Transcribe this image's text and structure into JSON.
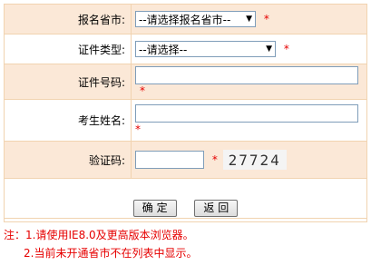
{
  "form": {
    "province": {
      "label": "报名省市:",
      "selected": "--请选择报名省市--",
      "required": "*"
    },
    "id_type": {
      "label": "证件类型:",
      "selected": "--请选择--",
      "required": "*"
    },
    "id_number": {
      "label": "证件号码:",
      "value": "",
      "required": "*"
    },
    "name": {
      "label": "考生姓名:",
      "value": "",
      "required": "*"
    },
    "captcha": {
      "label": "验证码:",
      "value": "",
      "required": "*",
      "image_text": "27724"
    }
  },
  "buttons": {
    "confirm": "确 定",
    "back": "返 回"
  },
  "notes": {
    "line1": "注：1.请使用IE8.0及更高版本浏览器。",
    "line2": "2.当前未开通省市不在列表中显示。"
  },
  "colors": {
    "row_shade": "#fbe8d7",
    "border": "#f1d3b0",
    "required": "#e60000"
  }
}
